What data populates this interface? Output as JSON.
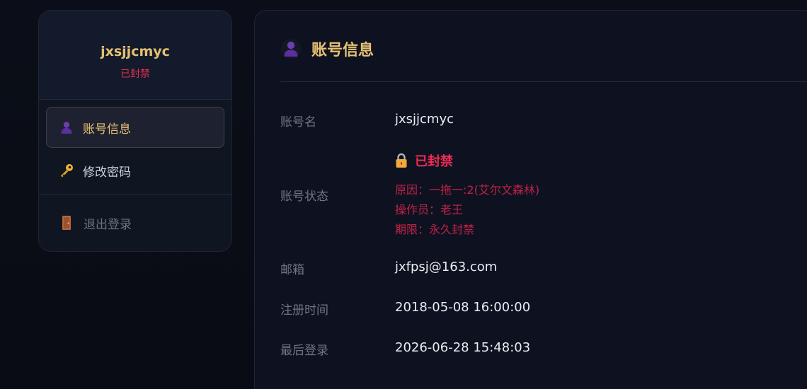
{
  "sidebar": {
    "username": "jxsjjcmyc",
    "status": "已封禁",
    "nav": [
      {
        "label": "账号信息",
        "icon": "user-icon"
      },
      {
        "label": "修改密码",
        "icon": "key-icon"
      }
    ],
    "logout_label": "退出登录"
  },
  "main": {
    "title": "账号信息",
    "rows": {
      "account_name": {
        "label": "账号名",
        "value": "jxsjjcmyc"
      },
      "account_status": {
        "label": "账号状态",
        "value": "已封禁",
        "reason": "原因：一拖一:2(艾尔文森林)",
        "operator": "操作员：老王",
        "period": "期限：永久封禁"
      },
      "email": {
        "label": "邮箱",
        "value": "jxfpsj@163.com"
      },
      "register_time": {
        "label": "注册时间",
        "value": "2018-05-08 16:00:00"
      },
      "last_login": {
        "label": "最后登录",
        "value": "2026-06-28 15:48:03"
      }
    }
  },
  "colors": {
    "accent_gold": "#e6c173",
    "ban_red": "#ef2a55"
  }
}
